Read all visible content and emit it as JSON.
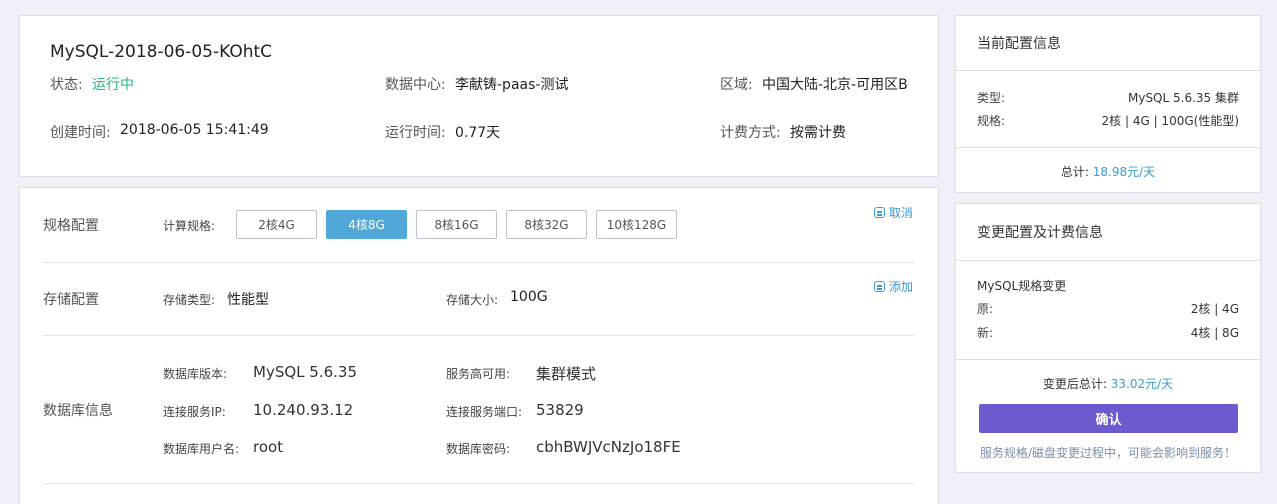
{
  "instance": {
    "name": "MySQL-2018-06-05-KOhtC",
    "status_label": "状态:",
    "status_value": "运行中",
    "datacenter_label": "数据中心:",
    "datacenter_value": "李献铸-paas-测试",
    "region_label": "区域:",
    "region_value": "中国大陆-北京-可用区B",
    "created_label": "创建时间:",
    "created_value": "2018-06-05 15:41:49",
    "runtime_label": "运行时间:",
    "runtime_value": "0.77天",
    "billing_label": "计费方式:",
    "billing_value": "按需计费"
  },
  "spec": {
    "section_title": "规格配置",
    "compute_label": "计算规格:",
    "options": [
      "2核4G",
      "4核8G",
      "8核16G",
      "8核32G",
      "10核128G"
    ],
    "selected": "4核8G",
    "cancel_label": "取消"
  },
  "storage": {
    "section_title": "存储配置",
    "type_label": "存储类型:",
    "type_value": "性能型",
    "size_label": "存储大小:",
    "size_value": "100G",
    "add_label": "添加"
  },
  "db": {
    "section_title": "数据库信息",
    "version_label": "数据库版本:",
    "version_value": "MySQL 5.6.35",
    "ha_label": "服务高可用:",
    "ha_value": "集群模式",
    "ip_label": "连接服务IP:",
    "ip_value": "10.240.93.12",
    "port_label": "连接服务端口:",
    "port_value": "53829",
    "user_label": "数据库用户名:",
    "user_value": "root",
    "pwd_label": "数据库密码:",
    "pwd_value": "cbhBWJVcNzJo18FE"
  },
  "current": {
    "title": "当前配置信息",
    "type_label": "类型:",
    "type_value": "MySQL 5.6.35 集群",
    "spec_label": "规格:",
    "spec_value": "2核 | 4G | 100G(性能型)",
    "total_label": "总计:",
    "total_value": "18.98元/天"
  },
  "change": {
    "title": "变更配置及计费信息",
    "subtitle": "MySQL规格变更",
    "orig_label": "原:",
    "orig_value": "2核 | 4G",
    "new_label": "新:",
    "new_value": "4核 | 8G",
    "total_label": "变更后总计:",
    "total_value": "33.02元/天",
    "confirm_label": "确认",
    "warning": "服务规格/磁盘变更过程中，可能会影响到服务！"
  },
  "colors": {
    "accent": "#6b5bcf",
    "link": "#3a9bd5",
    "running": "#2bb673",
    "selected": "#4fa8d8",
    "background": "#f0f1f8"
  }
}
